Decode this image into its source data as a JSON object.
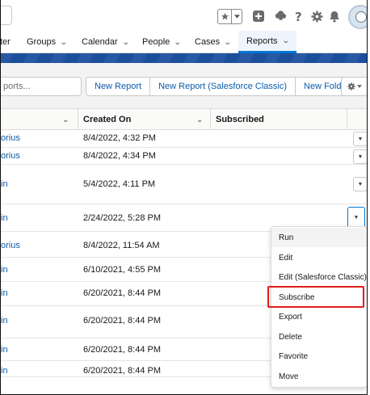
{
  "header": {
    "icons": [
      "star-icon",
      "caret-down-icon",
      "plus-icon",
      "trailhead-icon",
      "help-icon",
      "gear-icon",
      "bell-icon",
      "avatar"
    ]
  },
  "nav": {
    "items": [
      {
        "label": "ter",
        "chevron": false
      },
      {
        "label": "Groups",
        "chevron": true
      },
      {
        "label": "Calendar",
        "chevron": true
      },
      {
        "label": "People",
        "chevron": true
      },
      {
        "label": "Cases",
        "chevron": true
      },
      {
        "label": "Reports",
        "chevron": true
      }
    ],
    "active": "Reports"
  },
  "toolbar": {
    "search_placeholder": "ports...",
    "buttons": [
      "New Report",
      "New Report (Salesforce Classic)",
      "New Folder"
    ]
  },
  "table": {
    "columns": [
      "Created On",
      "Subscribed"
    ],
    "rows": [
      {
        "name": "orius",
        "created": "8/4/2022, 4:32 PM"
      },
      {
        "name": "orius",
        "created": "8/4/2022, 4:34 PM"
      },
      {
        "name": "in",
        "created": "5/4/2022, 4:11 PM"
      },
      {
        "name": "in",
        "created": "2/24/2022, 5:28 PM"
      },
      {
        "name": "orius",
        "created": "8/4/2022, 11:54 AM"
      },
      {
        "name": "in",
        "created": "6/10/2021, 4:55 PM"
      },
      {
        "name": "in",
        "created": "6/20/2021, 8:44 PM"
      },
      {
        "name": "in",
        "created": "6/20/2021, 8:44 PM"
      },
      {
        "name": "in",
        "created": "6/20/2021, 8:44 PM"
      },
      {
        "name": "in",
        "created": "6/20/2021, 8:44 PM"
      }
    ]
  },
  "menu": {
    "items": [
      "Run",
      "Edit",
      "Edit (Salesforce Classic)",
      "Subscribe",
      "Export",
      "Delete",
      "Favorite",
      "Move"
    ],
    "highlighted": "Subscribe",
    "highlight_color": "#e01e1e"
  },
  "colors": {
    "link": "#0b5cab",
    "brand_band": "#1b4f9c",
    "active_tab_underline": "#0176d3"
  }
}
